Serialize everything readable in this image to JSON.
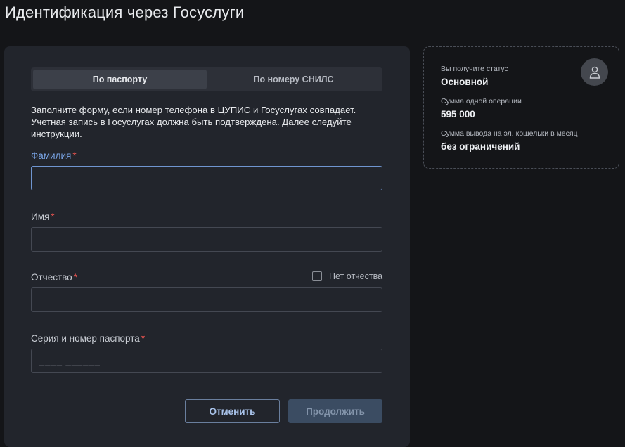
{
  "page": {
    "title": "Идентификация через Госуслуги"
  },
  "tabs": [
    {
      "label": "По паспорту",
      "active": true
    },
    {
      "label": "По номеру СНИЛС",
      "active": false
    }
  ],
  "form": {
    "intro": "Заполните форму, если номер телефона в ЦУПИС и Госуслугах совпадает. Учетная запись в Госуслугах должна быть подтверждена. Далее следуйте инструкции.",
    "required_mark": "*",
    "fields": {
      "surname": {
        "label": "Фамилия",
        "value": "",
        "placeholder": ""
      },
      "name": {
        "label": "Имя",
        "value": "",
        "placeholder": ""
      },
      "patronymic": {
        "label": "Отчество",
        "value": "",
        "placeholder": ""
      },
      "passport": {
        "label": "Серия и номер паспорта",
        "value": "",
        "placeholder": "____ ______"
      }
    },
    "no_patronymic_label": "Нет отчества",
    "cancel_label": "Отменить",
    "continue_label": "Продолжить"
  },
  "status_card": {
    "status_label": "Вы получите статус",
    "status_value": "Основной",
    "op_label": "Сумма одной операции",
    "op_value": "595 000",
    "withdraw_label": "Сумма вывода на эл. кошельки в месяц",
    "withdraw_value": "без ограничений"
  },
  "colors": {
    "background": "#141518",
    "card": "#22252c",
    "accent": "#7aa6e8",
    "required": "#e0524f"
  },
  "icons": {
    "avatar": "user-icon"
  }
}
